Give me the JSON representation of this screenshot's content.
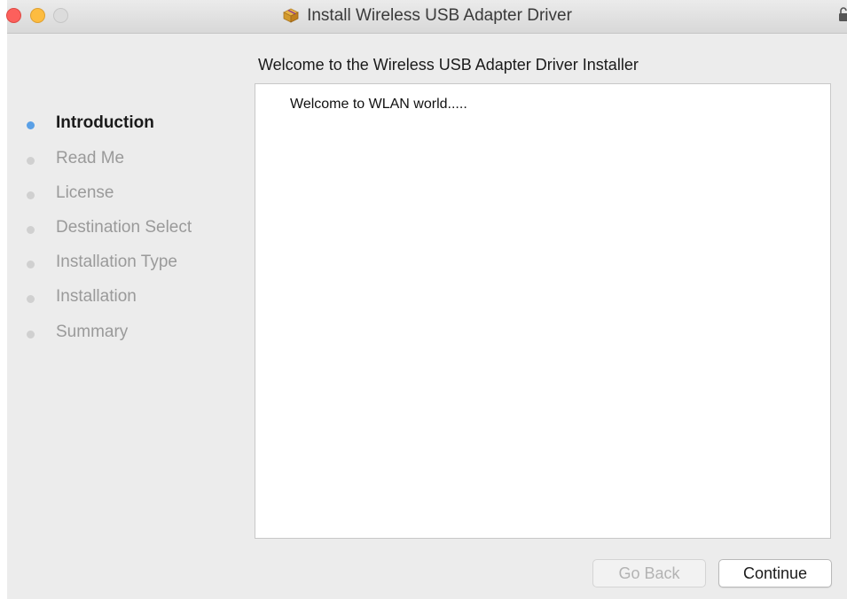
{
  "window": {
    "title": "Install Wireless USB Adapter Driver"
  },
  "heading": "Welcome to the Wireless USB Adapter Driver Installer",
  "content": {
    "text": "Welcome to WLAN world....."
  },
  "steps": [
    {
      "label": "Introduction",
      "active": true
    },
    {
      "label": "Read Me",
      "active": false
    },
    {
      "label": "License",
      "active": false
    },
    {
      "label": "Destination Select",
      "active": false
    },
    {
      "label": "Installation Type",
      "active": false
    },
    {
      "label": "Installation",
      "active": false
    },
    {
      "label": "Summary",
      "active": false
    }
  ],
  "buttons": {
    "back": "Go Back",
    "continue": "Continue"
  },
  "colors": {
    "close": "#fc605c",
    "minimize": "#fdbc40",
    "active_step_dot": "#5aa0e6"
  },
  "icons": {
    "title": "package-icon",
    "lock": "lock-icon"
  }
}
